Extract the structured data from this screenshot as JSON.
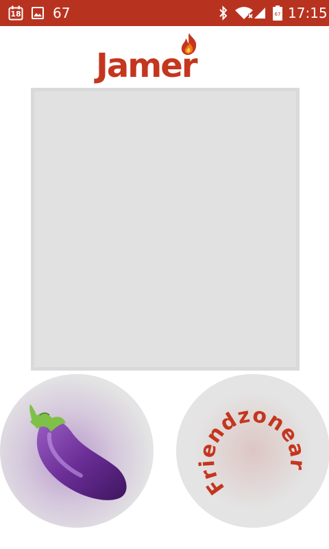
{
  "status_bar": {
    "calendar_day": "18",
    "notification_count": "67",
    "battery_level": "67",
    "time": "17:15",
    "background_color": "#b8331f",
    "icons": [
      "calendar-icon",
      "image-icon",
      "bluetooth-icon",
      "wifi-icon",
      "signal-icon",
      "battery-icon"
    ]
  },
  "header": {
    "logo_text": "Jamer",
    "logo_icon": "flame-icon",
    "brand_color": "#c4361e"
  },
  "profile": {
    "photo_placeholder_color": "#e1e1e1"
  },
  "actions": {
    "like_button_icon": "eggplant-icon",
    "friendzone_label": "Friendzonear"
  }
}
